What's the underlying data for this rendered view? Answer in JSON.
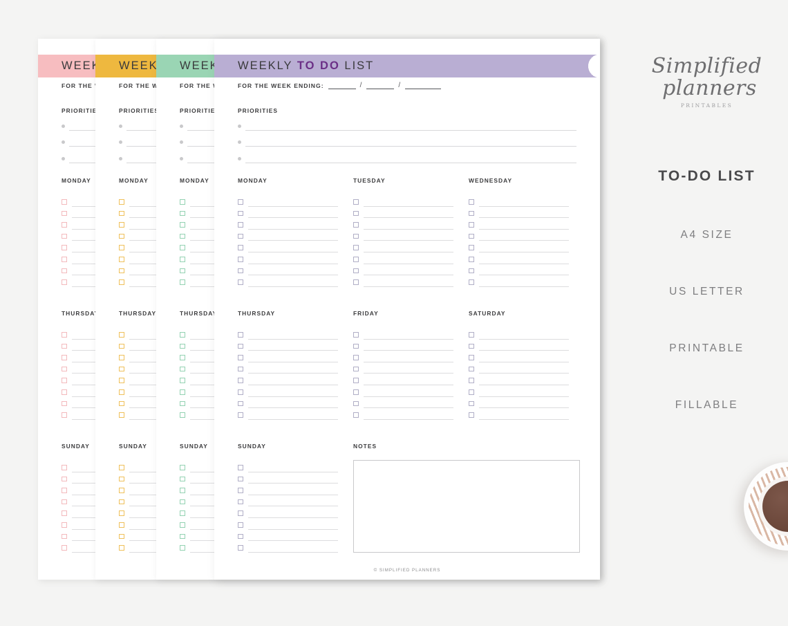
{
  "background_color": "#f4f4f3",
  "sheets": [
    {
      "id": "sheet-pink",
      "color": "#f7bdc0",
      "checkbox_color": "#f3b9bc"
    },
    {
      "id": "sheet-yellow",
      "color": "#eeb83f",
      "checkbox_color": "#efc05a"
    },
    {
      "id": "sheet-green",
      "color": "#9ad5b4",
      "checkbox_color": "#93d2b2"
    },
    {
      "id": "sheet-purple",
      "color": "#b9aed3",
      "checkbox_color": "#b0aec6"
    }
  ],
  "banner": {
    "title_prefix": "WEEKLY",
    "title_accent": "TO DO",
    "title_suffix": "LIST",
    "accent_color": "#6b2f86"
  },
  "page": {
    "week_ending_label": "FOR THE WEEK ENDING:",
    "date_separator": "/",
    "priorities_label": "PRIORITIES",
    "priorities_rows": 3,
    "notes_label": "NOTES",
    "tasks_per_day": 8,
    "footer": "© SIMPLIFIED PLANNERS",
    "days": [
      [
        "MONDAY",
        "TUESDAY",
        "WEDNESDAY"
      ],
      [
        "THURSDAY",
        "FRIDAY",
        "SATURDAY"
      ],
      [
        "SUNDAY"
      ]
    ]
  },
  "info": {
    "logo_line1": "Simplified",
    "logo_line2": "planners",
    "logo_sub": "PRINTABLES",
    "title": "TO-DO LIST",
    "features": [
      "A4 SIZE",
      "US LETTER",
      "PRINTABLE",
      "FILLABLE"
    ]
  }
}
